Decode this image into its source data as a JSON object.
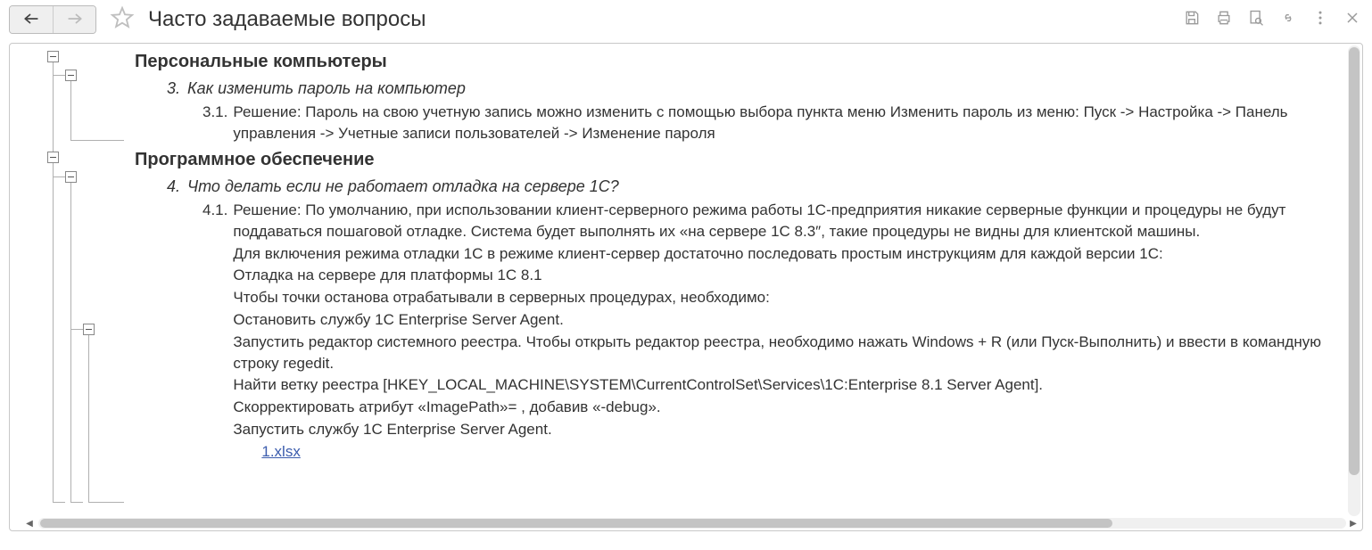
{
  "header": {
    "title": "Часто задаваемые вопросы"
  },
  "sections": {
    "s0": {
      "title": "Персональные компьютеры",
      "q": {
        "num": "3.",
        "text": "Как изменить пароль на компьютер",
        "a": {
          "num": "3.1.",
          "lines": [
            "Решение: Пароль на свою учетную запись можно изменить с помощью выбора пункта меню Изменить пароль из меню: Пуск -> Настройка -> Панель управления -> Учетные записи пользователей -> Изменение пароля"
          ]
        }
      }
    },
    "s1": {
      "title": "Программное обеспечение",
      "q": {
        "num": "4.",
        "text": "Что делать если не работает отладка на сервере 1С?",
        "a": {
          "num": "4.1.",
          "lines": [
            "Решение: По умолчанию, при использовании клиент-серверного режима работы 1С-предприятия никакие серверные функции и процедуры не будут поддаваться пошаговой отладке. Система будет выполнять их «на сервере 1С 8.3″, такие процедуры не видны для клиентской машины.",
            "Для включения режима отладки 1С в режиме клиент-сервер достаточно последовать простым инструкциям для каждой версии 1С:",
            "Отладка на сервере для платформы 1С 8.1",
            "Чтобы точки останова отрабатывали в серверных процедурах, необходимо:",
            "Остановить службу 1C Enterprise Server Agent.",
            "Запустить редактор системного реестра. Чтобы открыть редактор реестра, необходимо нажать Windows + R (или Пуск-Выполнить) и ввести в командную строку regedit.",
            "Найти ветку реестра [HKEY_LOCAL_MACHINE\\SYSTEM\\CurrentControlSet\\Services\\1C:Enterprise 8.1 Server Agent].",
            "Скорректировать атрибут «ImagePath»= , добавив «-debug».",
            "Запустить службу 1C Enterprise Server Agent."
          ],
          "attachment": "1.xlsx"
        }
      }
    }
  }
}
